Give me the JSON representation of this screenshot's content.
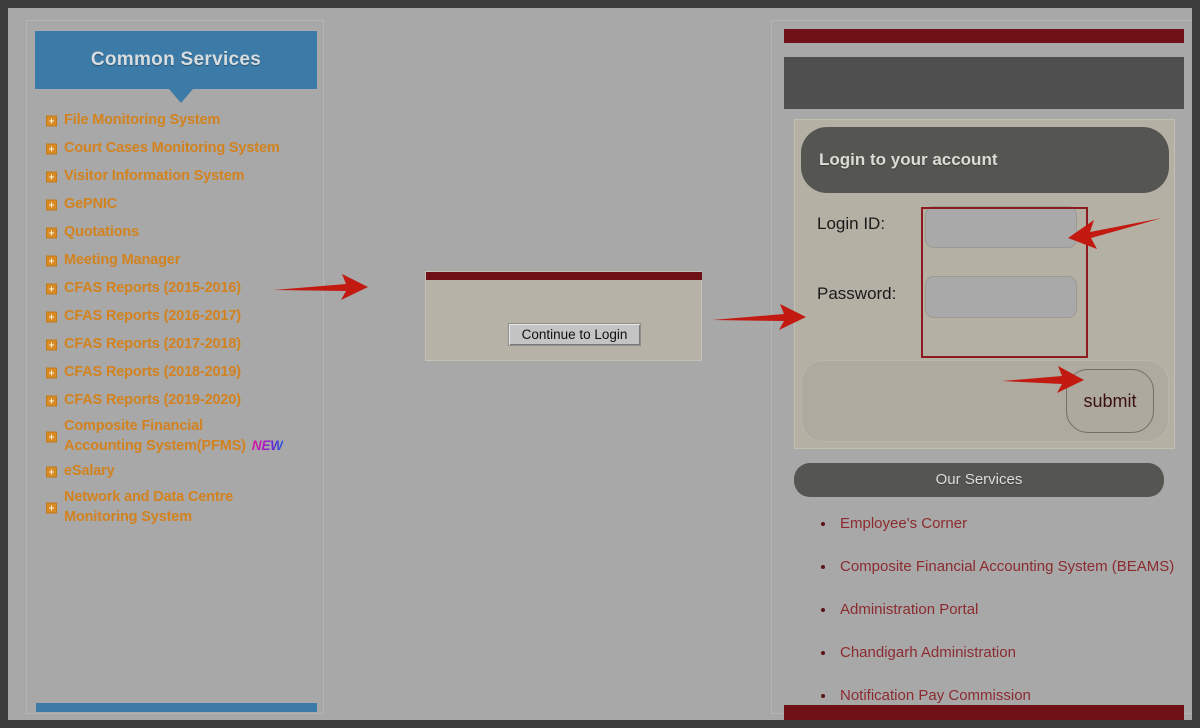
{
  "sidebar": {
    "header_title": "Common Services",
    "accent_color": "#3c7ba8",
    "item_color": "#d2821e",
    "items": [
      {
        "label": "File Monitoring System",
        "icon": "plus-box-icon"
      },
      {
        "label": "Court Cases Monitoring System",
        "icon": "plus-box-icon"
      },
      {
        "label": "Visitor Information System",
        "icon": "plus-box-icon"
      },
      {
        "label": "GePNIC",
        "icon": "plus-box-icon"
      },
      {
        "label": "Quotations",
        "icon": "plus-box-icon"
      },
      {
        "label": "Meeting Manager",
        "icon": "plus-box-icon"
      },
      {
        "label": "CFAS Reports (2015-2016)",
        "icon": "plus-box-icon"
      },
      {
        "label": "CFAS Reports (2016-2017)",
        "icon": "plus-box-icon"
      },
      {
        "label": "CFAS Reports (2017-2018)",
        "icon": "plus-box-icon"
      },
      {
        "label": "CFAS Reports (2018-2019)",
        "icon": "plus-box-icon"
      },
      {
        "label": "CFAS Reports (2019-2020)",
        "icon": "plus-box-icon"
      },
      {
        "label_line1": "Composite Financial",
        "label_line2": "Accounting System(PFMS)",
        "badge": "NEW",
        "icon": "plus-box-icon"
      },
      {
        "label": "eSalary",
        "icon": "plus-box-icon"
      },
      {
        "label_line1": "Network and Data Centre",
        "label_line2": "Monitoring System",
        "icon": "plus-box-icon"
      }
    ]
  },
  "center_panel": {
    "continue_button_label": "Continue to Login",
    "bar_color": "#6e1016"
  },
  "login_panel": {
    "card_title": "Login to your account",
    "login_id_label": "Login ID:",
    "login_id_value": "",
    "login_id_placeholder": "",
    "password_label": "Password:",
    "password_value": "",
    "password_placeholder": "",
    "submit_label": "submit",
    "highlight_color": "#8c1a20",
    "bar_color": "#6e1016"
  },
  "our_services": {
    "title": "Our Services",
    "link_color": "#8c2b2f",
    "items": [
      "Employee's Corner",
      "Composite Financial Accounting System (BEAMS)",
      "Administration Portal",
      "Chandigarh Administration",
      "Notification Pay Commission"
    ]
  },
  "annotations": {
    "arrow_color": "#c21a10",
    "arrows": [
      {
        "name": "arrow-sidebar-to-center",
        "direction": "right"
      },
      {
        "name": "arrow-center-to-login",
        "direction": "right"
      },
      {
        "name": "arrow-to-credential-fields",
        "direction": "left"
      },
      {
        "name": "arrow-to-submit-button",
        "direction": "right"
      }
    ]
  }
}
